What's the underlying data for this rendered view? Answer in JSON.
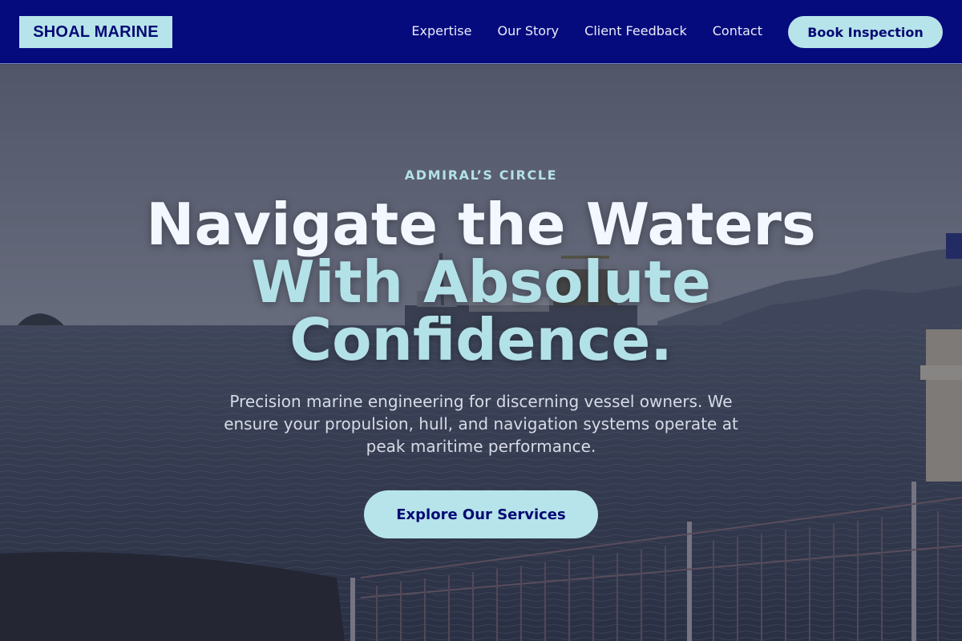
{
  "header": {
    "logo": "SHOAL MARINE",
    "nav": [
      "Expertise",
      "Our Story",
      "Client Feedback",
      "Contact"
    ],
    "cta": "Book Inspection"
  },
  "hero": {
    "eyebrow": "ADMIRAL’S CIRCLE",
    "headline_line1": "Navigate the Waters",
    "headline_line2a": "With Absolute",
    "headline_line2b": "Confidence.",
    "subtitle": "Precision marine engineering for discerning vessel owners. We ensure your propulsion, hull, and navigation systems operate at peak maritime performance.",
    "cta": "Explore Our Services"
  },
  "colors": {
    "header_bg": "#050a7d",
    "accent": "#b6e4ea",
    "accent_text": "#060a73"
  }
}
